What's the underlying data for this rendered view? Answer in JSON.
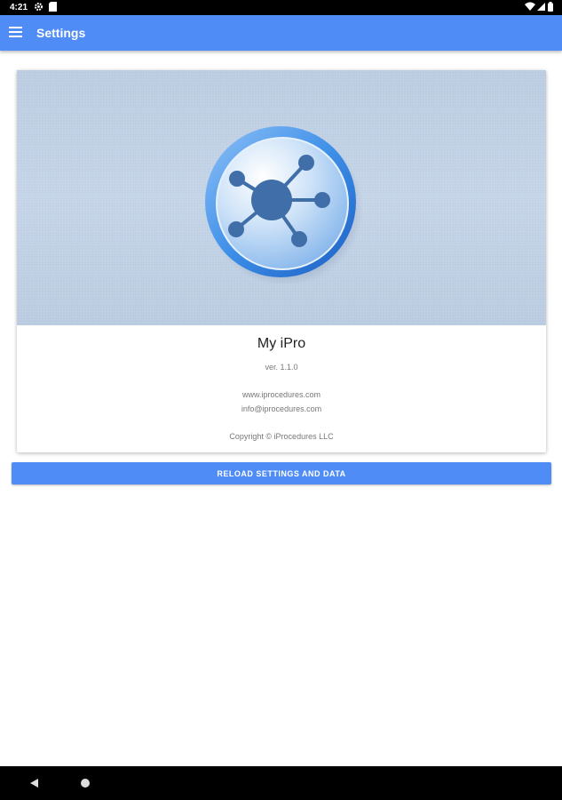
{
  "status_bar": {
    "time": "4:21",
    "icons": [
      "gear-icon",
      "sd-card-icon",
      "wifi-icon",
      "cell-signal-icon",
      "battery-icon"
    ]
  },
  "app_bar": {
    "title": "Settings",
    "menu_icon": "hamburger-menu-icon",
    "color": "#4f8cf6"
  },
  "about_card": {
    "logo_icon": "network-nodes-logo-icon",
    "app_name": "My iPro",
    "version": "ver. 1.1.0",
    "website": "www.iprocedures.com",
    "email": "info@iprocedures.com",
    "copyright": "Copyright © iProcedures LLC"
  },
  "reload_button": {
    "label": "RELOAD SETTINGS AND DATA",
    "color": "#4f8cf6"
  },
  "nav_bar": {
    "icons": [
      "back-icon",
      "home-icon"
    ]
  }
}
